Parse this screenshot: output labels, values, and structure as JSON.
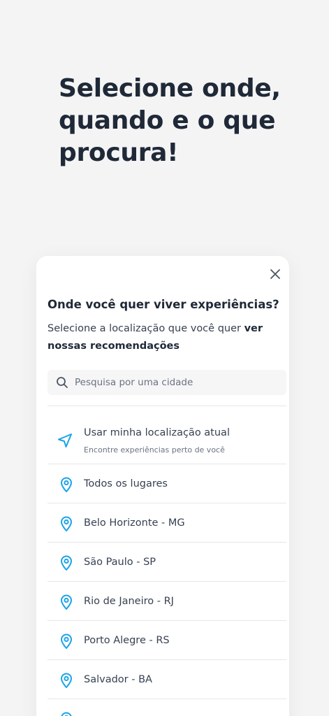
{
  "headline": [
    "Selecione onde,",
    "quando e o que",
    "procura!"
  ],
  "modal": {
    "title": "Onde você quer viver experiências?",
    "description_regular": "Selecione a localização que você quer ",
    "description_bold": "ver nossas recomendações",
    "search_placeholder": "Pesquisa por uma cidade",
    "current_location": {
      "label": "Usar minha localização atual",
      "sublabel": "Encontre experiências perto de você"
    },
    "locations": [
      "Todos os lugares",
      "Belo Horizonte - MG",
      "São Paulo - SP",
      "Rio de Janeiro - RJ",
      "Porto Alegre - RS",
      "Salvador - BA",
      ""
    ]
  },
  "colors": {
    "background": "#f4f4f5",
    "text_dark": "#1f2937",
    "accent": "#1aa3e8"
  },
  "icons": {
    "close": "close-icon",
    "search": "search-icon",
    "navigation": "navigation-arrow-icon",
    "location": "location-pin-icon"
  }
}
